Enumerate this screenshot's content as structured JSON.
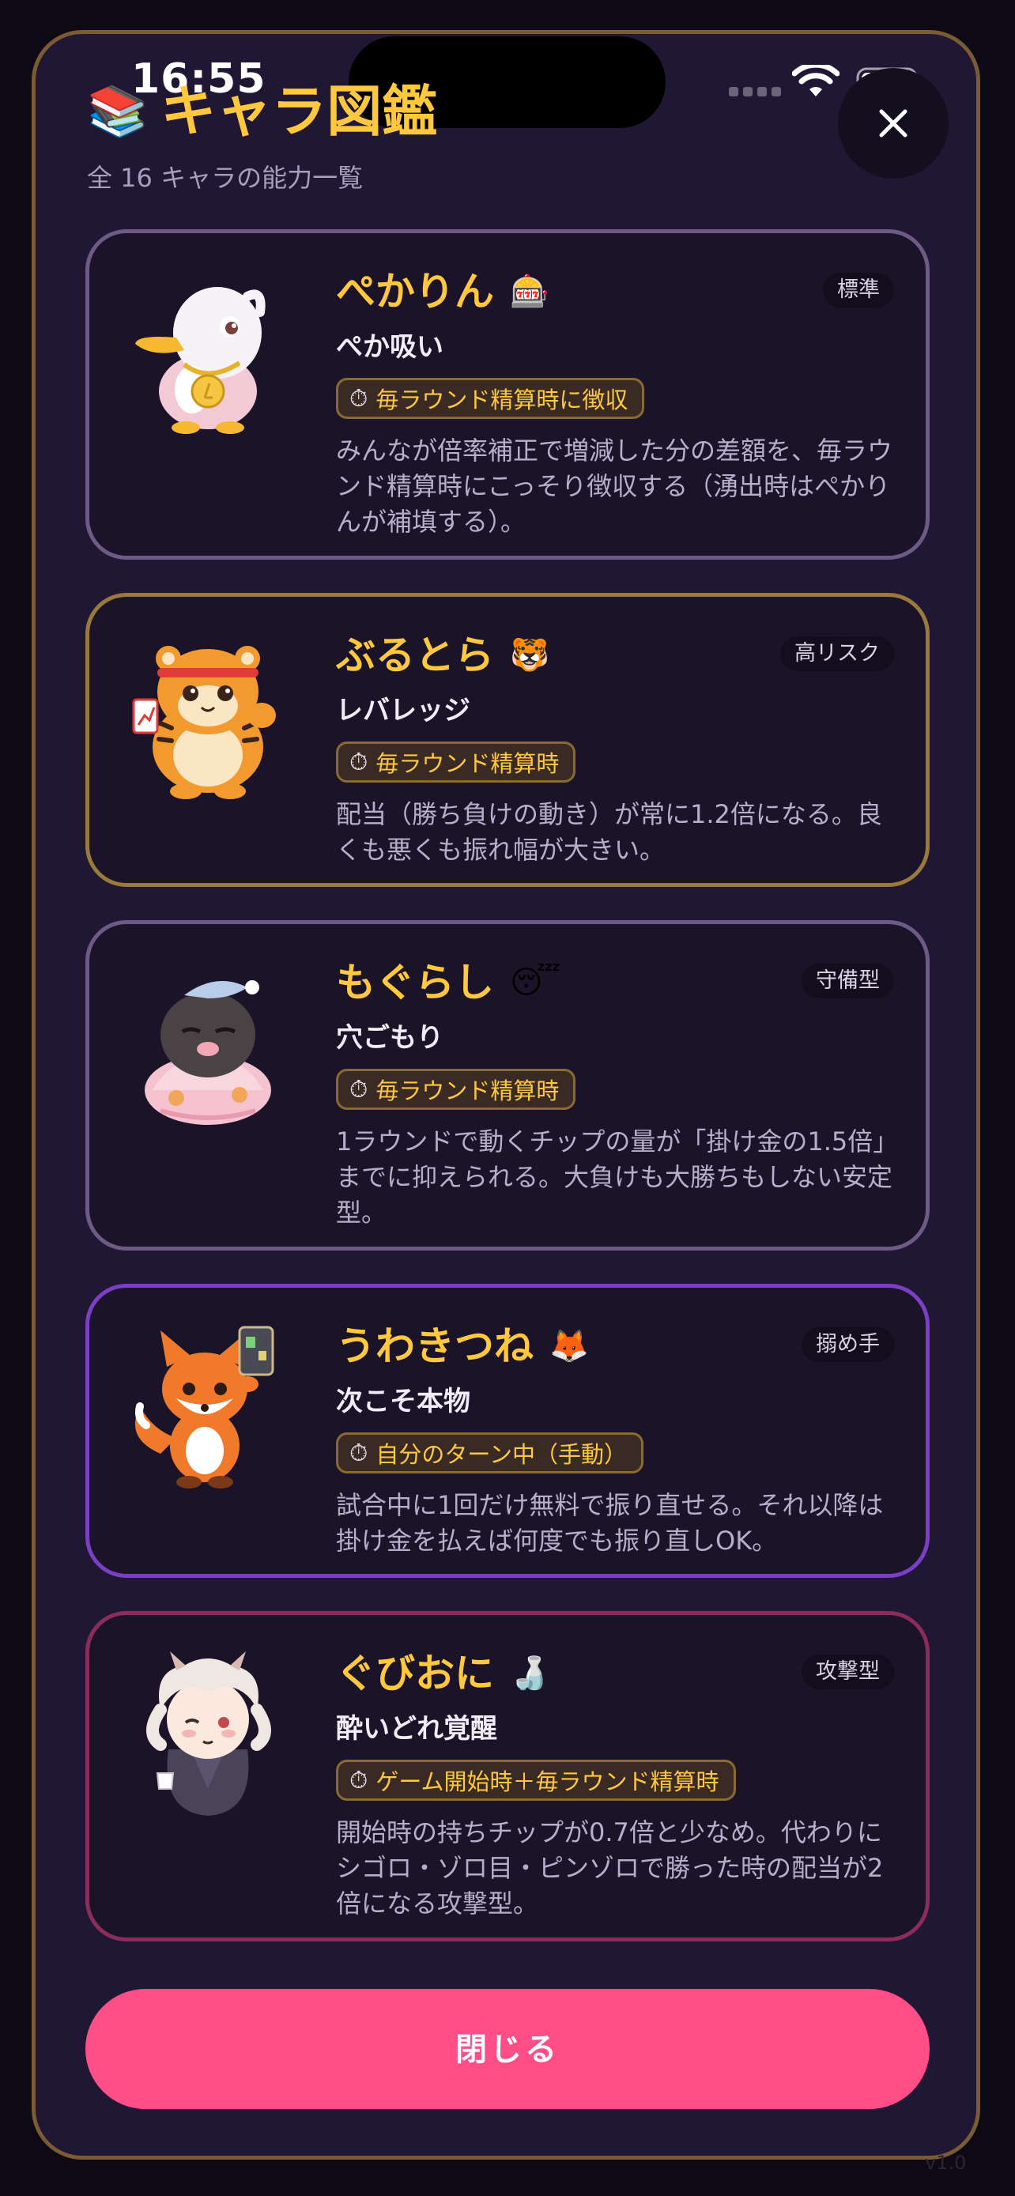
{
  "status_bar": {
    "time": "16:55"
  },
  "header": {
    "emoji": "📚",
    "title": "キャラ図鑑",
    "subtitle": "全 16 キャラの能力一覧",
    "close_icon": "close-icon"
  },
  "characters": [
    {
      "name": "ぺかりん",
      "emoji": "🎰",
      "tag": "標準",
      "ability": "ぺか吸い",
      "timing": "毎ラウンド精算時に徴収",
      "description": "みんなが倍率補正で増減した分の差額を、毎ラウンド精算時にこっそり徴収する（湧出時はぺかりんが補填する）。",
      "border_color": "#6e5a86",
      "avatar": "white-duck"
    },
    {
      "name": "ぶるとら",
      "emoji": "🐯",
      "tag": "高リスク",
      "ability": "レバレッジ",
      "timing": "毎ラウンド精算時",
      "description": "配当（勝ち負けの動き）が常に1.2倍になる。良くも悪くも振れ幅が大きい。",
      "border_color": "#9a7a3a",
      "avatar": "tiger"
    },
    {
      "name": "もぐらし",
      "emoji": "😴",
      "tag": "守備型",
      "ability": "穴ごもり",
      "timing": "毎ラウンド精算時",
      "description": "1ラウンドで動くチップの量が「掛け金の1.5倍」までに抑えられる。大負けも大勝ちもしない安定型。",
      "border_color": "#6e5a86",
      "avatar": "mole"
    },
    {
      "name": "うわきつね",
      "emoji": "🦊",
      "tag": "搦め手",
      "ability": "次こそ本物",
      "timing": "自分のターン中（手動）",
      "description": "試合中に1回だけ無料で振り直せる。それ以降は掛け金を払えば何度でも振り直しOK。",
      "border_color": "#7b3fc4",
      "avatar": "fox"
    },
    {
      "name": "ぐびおに",
      "emoji": "🍶",
      "tag": "攻撃型",
      "ability": "酔いどれ覚醒",
      "timing": "ゲーム開始時＋毎ラウンド精算時",
      "description": "開始時の持ちチップが0.7倍と少なめ。代わりにシゴロ・ゾロ目・ピンゾロで勝った時の配当が2倍になる攻撃型。",
      "border_color": "#8a2d5a",
      "avatar": "oni"
    }
  ],
  "footer": {
    "close_label": "閉じる",
    "version": "v1.0"
  },
  "colors": {
    "accent": "#ffc83d",
    "button": "#ff4d88",
    "modal_border": "#7a5b33",
    "background": "#201735"
  }
}
